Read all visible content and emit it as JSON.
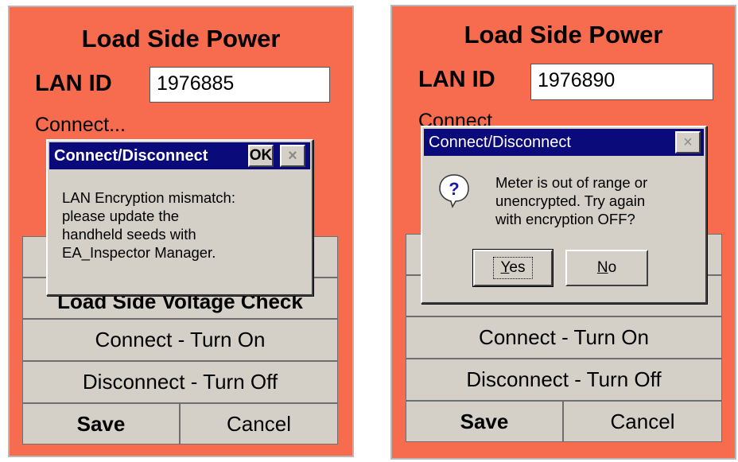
{
  "left": {
    "title": "Load Side Power",
    "lan_label": "LAN ID",
    "lan_value": "1976885",
    "status": "Connect...",
    "button_hidden_top": "",
    "button_voltage": "Load Side Voltage Check",
    "button_connect": "Connect - Turn On",
    "button_disconnect": "Disconnect - Turn Off",
    "button_save": "Save",
    "button_cancel": "Cancel",
    "dialog": {
      "title": "Connect/Disconnect",
      "ok_label": "OK",
      "close_label": "×",
      "message_lines": [
        "LAN Encryption mismatch:",
        "please update the",
        "handheld seeds with",
        "EA_Inspector Manager."
      ]
    }
  },
  "right": {
    "title": "Load Side Power",
    "lan_label": "LAN ID",
    "lan_value": "1976890",
    "status": "Connect",
    "button_connect": "Connect - Turn On",
    "button_disconnect": "Disconnect - Turn Off",
    "button_save": "Save",
    "button_cancel": "Cancel",
    "dialog": {
      "title": "Connect/Disconnect",
      "close_label": "×",
      "icon": "question-icon",
      "message_lines": [
        "Meter is out of range or",
        "unencrypted. Try again",
        "with encryption OFF?"
      ],
      "yes_mnemonic": "Y",
      "yes_rest": "es",
      "no_mnemonic": "N",
      "no_rest": "o"
    }
  },
  "colors": {
    "screen_bg": "#f76b4f",
    "titlebar": "#0a0a7a",
    "dialog_bg": "#d4d0c8"
  }
}
